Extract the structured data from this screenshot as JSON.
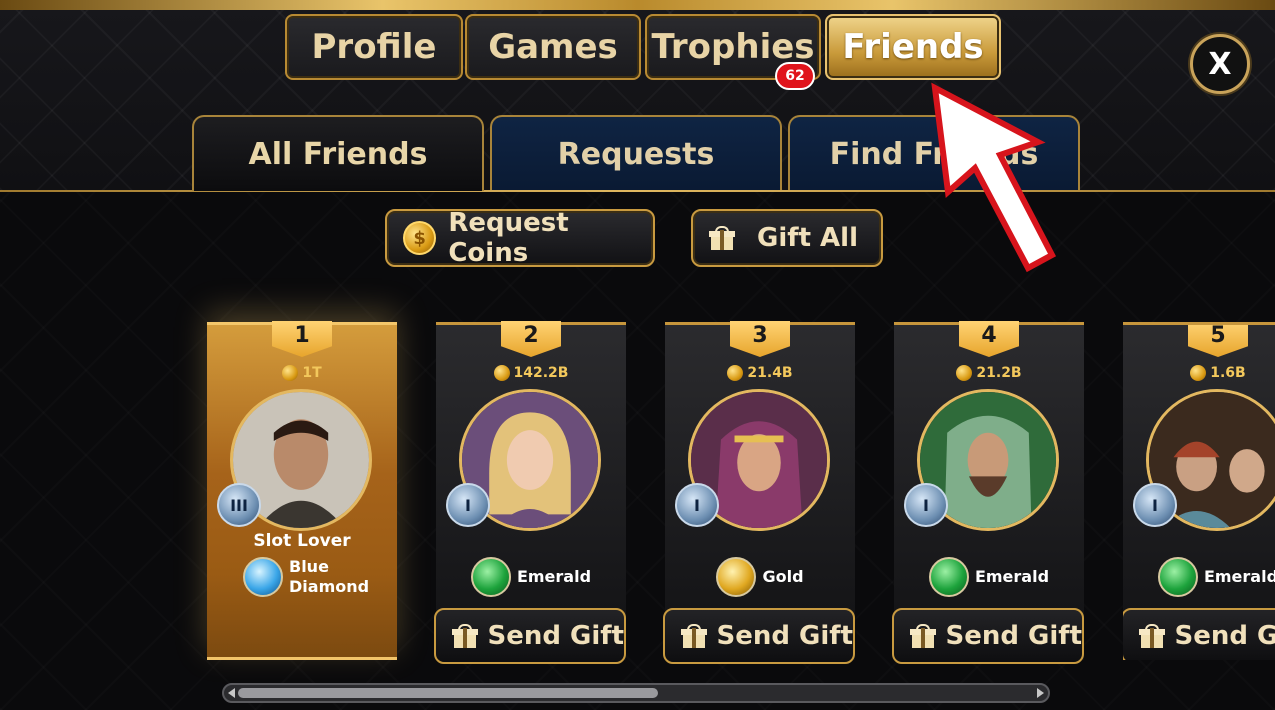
{
  "main_tabs": [
    {
      "label": "Profile"
    },
    {
      "label": "Games"
    },
    {
      "label": "Trophies",
      "badge": "62"
    },
    {
      "label": "Friends",
      "active": true
    }
  ],
  "close_label": "X",
  "sub_tabs": [
    {
      "label": "All Friends",
      "active": true
    },
    {
      "label": "Requests"
    },
    {
      "label": "Find Friends"
    }
  ],
  "actions": {
    "request_coins": "Request Coins",
    "gift_all": "Gift All"
  },
  "friends": [
    {
      "rank": "1",
      "coins": "1T",
      "vip": "III",
      "name": "Slot Lover",
      "tier": "Blue\nDiamond",
      "tier_type": "blue"
    },
    {
      "rank": "2",
      "coins": "142.2B",
      "vip": "I",
      "name": "",
      "tier": "Emerald",
      "tier_type": "emerald",
      "send": "Send Gift"
    },
    {
      "rank": "3",
      "coins": "21.4B",
      "vip": "I",
      "name": "",
      "tier": "Gold",
      "tier_type": "gold",
      "send": "Send Gift"
    },
    {
      "rank": "4",
      "coins": "21.2B",
      "vip": "I",
      "name": "",
      "tier": "Emerald",
      "tier_type": "emerald",
      "send": "Send Gift"
    },
    {
      "rank": "5",
      "coins": "1.6B",
      "vip": "I",
      "name": "",
      "tier": "Emerald",
      "tier_type": "emerald",
      "send": "Send Gift"
    }
  ],
  "colors": {
    "accent_gold": "#c89a40",
    "active_tab": "#e8c270",
    "badge_red": "#e0141c",
    "subtab_blue": "#0f2443"
  }
}
